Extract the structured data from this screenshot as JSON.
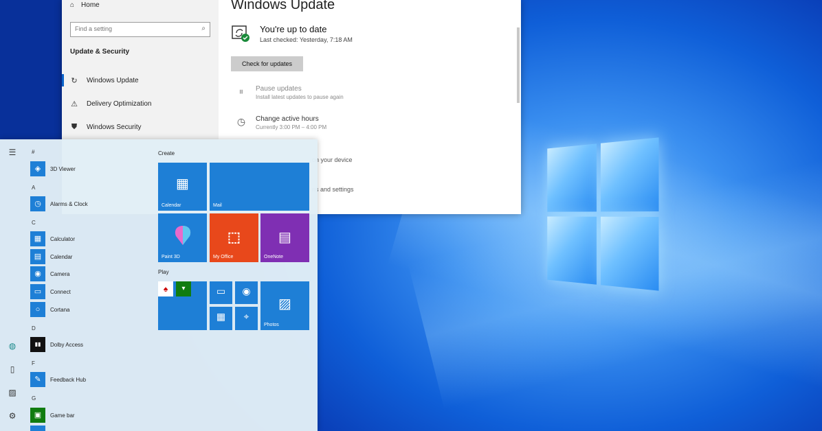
{
  "settings": {
    "nav": {
      "home_label": "Home",
      "search_placeholder": "Find a setting",
      "section_title": "Update & Security",
      "items": [
        {
          "label": "Windows Update",
          "icon": "refresh-icon"
        },
        {
          "label": "Delivery Optimization",
          "icon": "delivery-icon"
        },
        {
          "label": "Windows Security",
          "icon": "shield-icon"
        }
      ]
    },
    "content": {
      "title": "Windows Update",
      "status_title": "You're up to date",
      "status_sub": "Last checked: Yesterday, 7:18 AM",
      "check_button": "Check for updates",
      "options": [
        {
          "title": "Pause updates",
          "sub": "Install latest updates to pause again",
          "icon": "pause-icon"
        },
        {
          "title": "Change active hours",
          "sub": "Currently 3:00 PM – 4:00 PM",
          "icon": "clock-icon"
        }
      ],
      "partial_options": [
        "on your device",
        "ns and settings"
      ]
    }
  },
  "start_menu": {
    "rail_icons": [
      "hamburger-icon",
      "globe-icon",
      "document-icon",
      "pictures-icon",
      "settings-icon"
    ],
    "letters": [
      "#",
      "A",
      "C",
      "D",
      "F",
      "G"
    ],
    "apps": [
      {
        "label": "3D Viewer",
        "glyph": "◈"
      },
      {
        "label": "Alarms & Clock",
        "glyph": "◷"
      },
      {
        "label": "Calculator",
        "glyph": "▦"
      },
      {
        "label": "Calendar",
        "glyph": "▤"
      },
      {
        "label": "Camera",
        "glyph": "◉"
      },
      {
        "label": "Connect",
        "glyph": "▭"
      },
      {
        "label": "Cortana",
        "glyph": "○"
      },
      {
        "label": "Dolby Access",
        "glyph": "▮▮"
      },
      {
        "label": "Feedback Hub",
        "glyph": "✎"
      },
      {
        "label": "Game bar",
        "glyph": "▣"
      }
    ],
    "groups": {
      "create": "Create",
      "play": "Play"
    },
    "tiles": {
      "calendar": "Calendar",
      "mail": "Mail",
      "paint3d": "Paint 3D",
      "office": "My Office",
      "onenote": "OneNote",
      "photos": "Photos"
    }
  },
  "colors": {
    "accent": "#1e7fd6",
    "office": "#e8481b",
    "onenote": "#7f2fb3",
    "xbox": "#107c10"
  }
}
